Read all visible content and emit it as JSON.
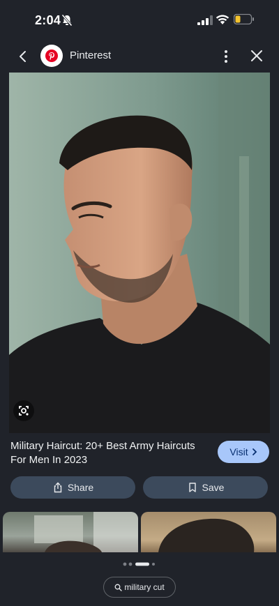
{
  "status_bar": {
    "time": "2:04",
    "icons": [
      "bell-muted-icon",
      "signal-icon",
      "wifi-icon",
      "battery-icon"
    ],
    "battery_color": "#f4c430"
  },
  "header": {
    "source_name": "Pinterest",
    "source_logo_color": "#e60023",
    "icons": [
      "back-arrow-icon",
      "pinterest-logo-icon",
      "more-vertical-icon",
      "close-icon"
    ]
  },
  "result": {
    "title": "Military Haircut: 20+ Best Army Haircuts For Men In 2023",
    "visit_label": "Visit",
    "share_label": "Share",
    "save_label": "Save",
    "accent_color": "#a8c7fa"
  },
  "related": {
    "count_visible": 2
  },
  "pager": {
    "total": 4,
    "active_index": 2
  },
  "search_chip": {
    "label": "military cut"
  }
}
